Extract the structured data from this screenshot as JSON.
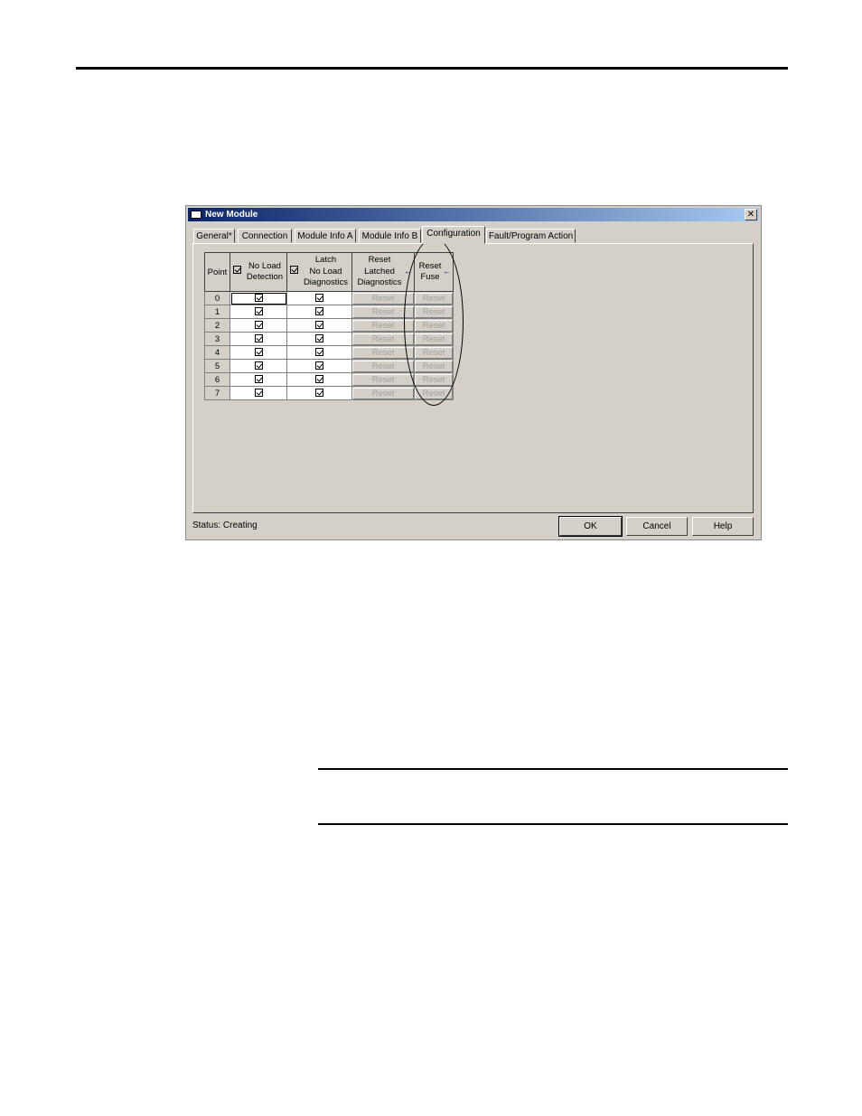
{
  "dialog": {
    "title": "New Module",
    "close_glyph": "✕",
    "tabs": [
      "General*",
      "Connection",
      "Module Info A",
      "Module Info B",
      "Configuration",
      "Fault/Program Action"
    ],
    "active_tab": "Configuration",
    "table": {
      "headers": {
        "point": "Point",
        "no_load_detection": [
          "No Load",
          "Detection"
        ],
        "latch_no_load": [
          "Latch",
          "No Load",
          "Diagnostics"
        ],
        "reset_latched": [
          "Reset",
          "Latched",
          "Diagnostics"
        ],
        "reset_fuse": [
          "Reset",
          "Fuse"
        ]
      },
      "reset_label": "Reset",
      "rows": [
        {
          "point": "0",
          "no_load_detection": true,
          "latch": true
        },
        {
          "point": "1",
          "no_load_detection": true,
          "latch": true
        },
        {
          "point": "2",
          "no_load_detection": true,
          "latch": true
        },
        {
          "point": "3",
          "no_load_detection": true,
          "latch": true
        },
        {
          "point": "4",
          "no_load_detection": true,
          "latch": true
        },
        {
          "point": "5",
          "no_load_detection": true,
          "latch": true
        },
        {
          "point": "6",
          "no_load_detection": true,
          "latch": true
        },
        {
          "point": "7",
          "no_load_detection": true,
          "latch": true
        }
      ]
    },
    "status_text": "Status:  Creating",
    "buttons": {
      "ok": "OK",
      "cancel": "Cancel",
      "help": "Help"
    }
  },
  "colors": {
    "title_start": "#0a246a",
    "title_end": "#a6caf0",
    "face": "#d4d0c8",
    "disabled_text": "#a0a0a0"
  }
}
